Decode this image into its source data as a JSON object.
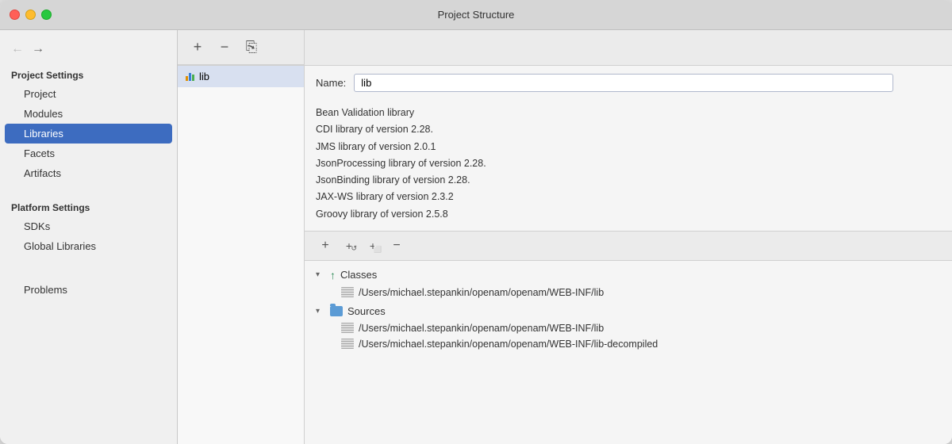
{
  "window": {
    "title": "Project Structure"
  },
  "sidebar": {
    "back_btn": "←",
    "forward_btn": "→",
    "project_settings_label": "Project Settings",
    "items": [
      {
        "id": "project",
        "label": "Project",
        "active": false
      },
      {
        "id": "modules",
        "label": "Modules",
        "active": false
      },
      {
        "id": "libraries",
        "label": "Libraries",
        "active": true
      },
      {
        "id": "facets",
        "label": "Facets",
        "active": false
      },
      {
        "id": "artifacts",
        "label": "Artifacts",
        "active": false
      }
    ],
    "platform_settings_label": "Platform Settings",
    "platform_items": [
      {
        "id": "sdks",
        "label": "SDKs",
        "active": false
      },
      {
        "id": "global-libraries",
        "label": "Global Libraries",
        "active": false
      }
    ],
    "problems_label": "Problems"
  },
  "toolbar": {
    "add_label": "+",
    "remove_label": "−",
    "copy_label": "⎘"
  },
  "list": {
    "item_label": "lib"
  },
  "detail": {
    "name_label": "Name:",
    "name_value": "lib",
    "descriptions": [
      "Bean Validation library",
      "CDI library of version 2.28.",
      "JMS library of version 2.0.1",
      "JsonProcessing library of version 2.28.",
      "JsonBinding library of version 2.28.",
      "JAX-WS library of version 2.3.2",
      "Groovy library of version 2.5.8"
    ]
  },
  "action_bar": {
    "add_btn": "+",
    "add_copy_btn": "+",
    "add_folder_btn": "+",
    "remove_btn": "−"
  },
  "tree": {
    "sections": [
      {
        "id": "classes",
        "label": "Classes",
        "expanded": true,
        "children": [
          {
            "path": "/Users/michael.stepankin/openam/openam/WEB-INF/lib"
          }
        ]
      },
      {
        "id": "sources",
        "label": "Sources",
        "expanded": true,
        "children": [
          {
            "path": "/Users/michael.stepankin/openam/openam/WEB-INF/lib"
          },
          {
            "path": "/Users/michael.stepankin/openam/openam/WEB-INF/lib-decompiled"
          }
        ]
      }
    ]
  }
}
